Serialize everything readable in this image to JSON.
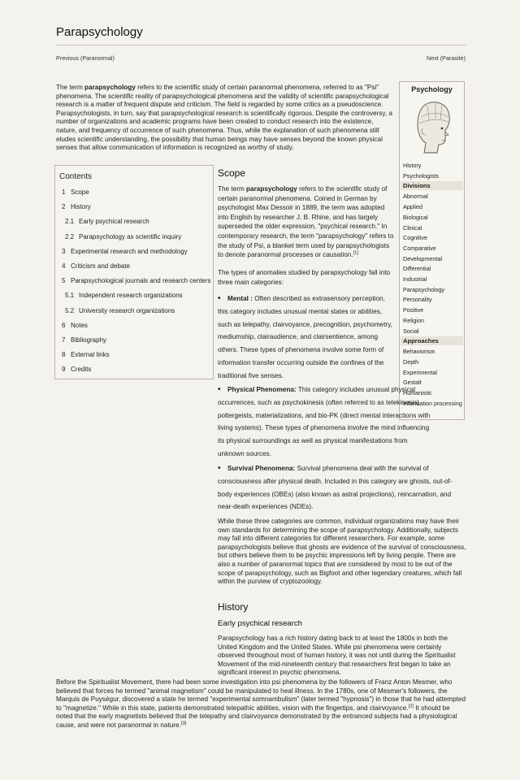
{
  "page": {
    "title": "Parapsychology",
    "prev_link": "Previous (Paranormal)",
    "next_link": "Next (Parasite)"
  },
  "intro": {
    "pre": "The term ",
    "term": "parapsychology",
    "post": " refers to the scientific study of certain paranormal phenomena, referred to as \"Psi\" phenomena. The scientific reality of parapsychological phenomena and the validity of scientific parapsychological research is a matter of frequent dispute and criticism. The field is regarded by some critics as a pseudoscience. Parapsychologists, in turn, say that parapsychological research is scientifically rigorous. Despite the controversy, a number of organizations and academic programs have been created to conduct research into the existence, nature, and frequency of occurrence of such phenomena. Thus, while the explanation of such phenomena still eludes scientific understanding, the possibility that human beings may have senses beyond the known physical senses that allow communication of information is recognized as worthy of study."
  },
  "infobox": {
    "title": "Psychology",
    "top_items": [
      "History",
      "Psychologists"
    ],
    "sections": [
      {
        "heading": "Divisions",
        "items": [
          "Abnormal",
          "Applied",
          "Biological",
          "Clinical",
          "Cognitive",
          "Comparative",
          "Developmental",
          "Differential",
          "Industrial",
          "Parapsychology",
          "Personality",
          "Positive",
          "Religion",
          "Social"
        ]
      },
      {
        "heading": "Approaches",
        "items": [
          "Behaviorism",
          "Depth",
          "Experimental",
          "Gestalt",
          "Humanistic",
          "Information processing"
        ]
      }
    ]
  },
  "toc": {
    "title": "Contents",
    "items": [
      {
        "num": "1",
        "label": "Scope"
      },
      {
        "num": "2",
        "label": "History"
      },
      {
        "num": "2.1",
        "label": "Early psychical research"
      },
      {
        "num": "2.2",
        "label": "Parapsychology as scientific inquiry"
      },
      {
        "num": "3",
        "label": "Experimental research and methodology"
      },
      {
        "num": "4",
        "label": "Criticism and debate"
      },
      {
        "num": "5",
        "label": "Parapsychological journals and research centers"
      },
      {
        "num": "5.1",
        "label": "Independent research organizations"
      },
      {
        "num": "5.2",
        "label": "University research organizations"
      },
      {
        "num": "6",
        "label": "Notes"
      },
      {
        "num": "7",
        "label": "Bibliography"
      },
      {
        "num": "8",
        "label": "External links"
      },
      {
        "num": "9",
        "label": "Credits"
      }
    ]
  },
  "scope": {
    "heading": "Scope",
    "p1_pre": "The term ",
    "p1_term": "parapsychology",
    "p1_post": " refers to the scientific study of certain paranormal phenomena. Coined in German by psychologist Max Dessoir in 1889, the term was adopted into English by researcher J. B. Rhine, and has largely superseded the older expression, \"psychical research.\" In contemporary research, the term \"parapsychology\" refers to the study of Psi, a blanket term used by parapsychologists to denote paranormal processes or causation.",
    "p1_ref": "[1]",
    "p2": "The types of anomalies studied by parapsychology fall into three main categories:",
    "bullets": [
      {
        "label": "Mental :",
        "text": " Often described as extrasensory perception, this category includes unusual mental states or abilities, such as telepathy, clairvoyance, precognition, psychometry, mediumship, clairaudience, and clairsentience, among others. These types of phenomena involve some form of information transfer occurring outside the confines of the traditional five senses."
      },
      {
        "label": "Physical Phenomena:",
        "text": " This category includes unusual physical occurrences, such as psychokinesis (often referred to as telekinesis), poltergeists, materializations, and bio-PK (direct mental interactions with living systems). These types of phenomena involve the mind influencing its physical surroundings as well as physical manifestations from unknown sources."
      },
      {
        "label": "Survival Phenomena:",
        "text": " Survival phenomena deal with the survival of consciousness after physical death. Included in this category are ghosts, out-of-body experiences (OBEs) (also known as astral projections), reincarnation, and near-death experiences (NDEs)."
      }
    ],
    "p3": "While these three categories are common, individual organizations may have their own standards for determining the scope of parapsychology. Additionally, subjects may fall into different categories for different researchers. For example, some parapsychologists believe that ghosts are evidence of the survival of consciousness, but others believe them to be psychic impressions left by living people. There are also a number of paranormal topics that are considered by most to be out of the scope of parapsychology, such as Bigfoot and other legendary creatures, which fall within the purview of cryptozoology."
  },
  "history": {
    "heading": "History",
    "sub_heading": "Early psychical research",
    "p1": "Parapsychology has a rich history dating back to at least the 1800s in both the United Kingdom and the United States. While psi phenomena were certainly observed throughout most of human history, it was not until during the Spiritualist Movement of the mid-nineteenth century that researchers first began to take an significant interest in psychic phenomena.",
    "p2_a": "Before the Spiritualist Movement, there had been some investigation into psi phenomena by the followers of Franz Anton Mesmer, who believed that forces he termed \"animal magnetism\" could be manipulated to heal illness. In the 1780s, one of Mesmer's followers, the Marquis de Puységur, discovered a state he termed \"experimental somnambulism\" (later termed \"hypnosis\") in those that he had attempted to \"magnetize.\" While in this state, patients demonstrated telepathic abilities, vision with the fingertips, and clairvoyance.",
    "p2_ref1": "[2]",
    "p2_b": " It should be noted that the early magnetists believed that the telepathy and clairvoyance demonstrated by the entranced subjects had a physiological cause, and were not paranormal in nature.",
    "p2_ref2": "[3]"
  }
}
